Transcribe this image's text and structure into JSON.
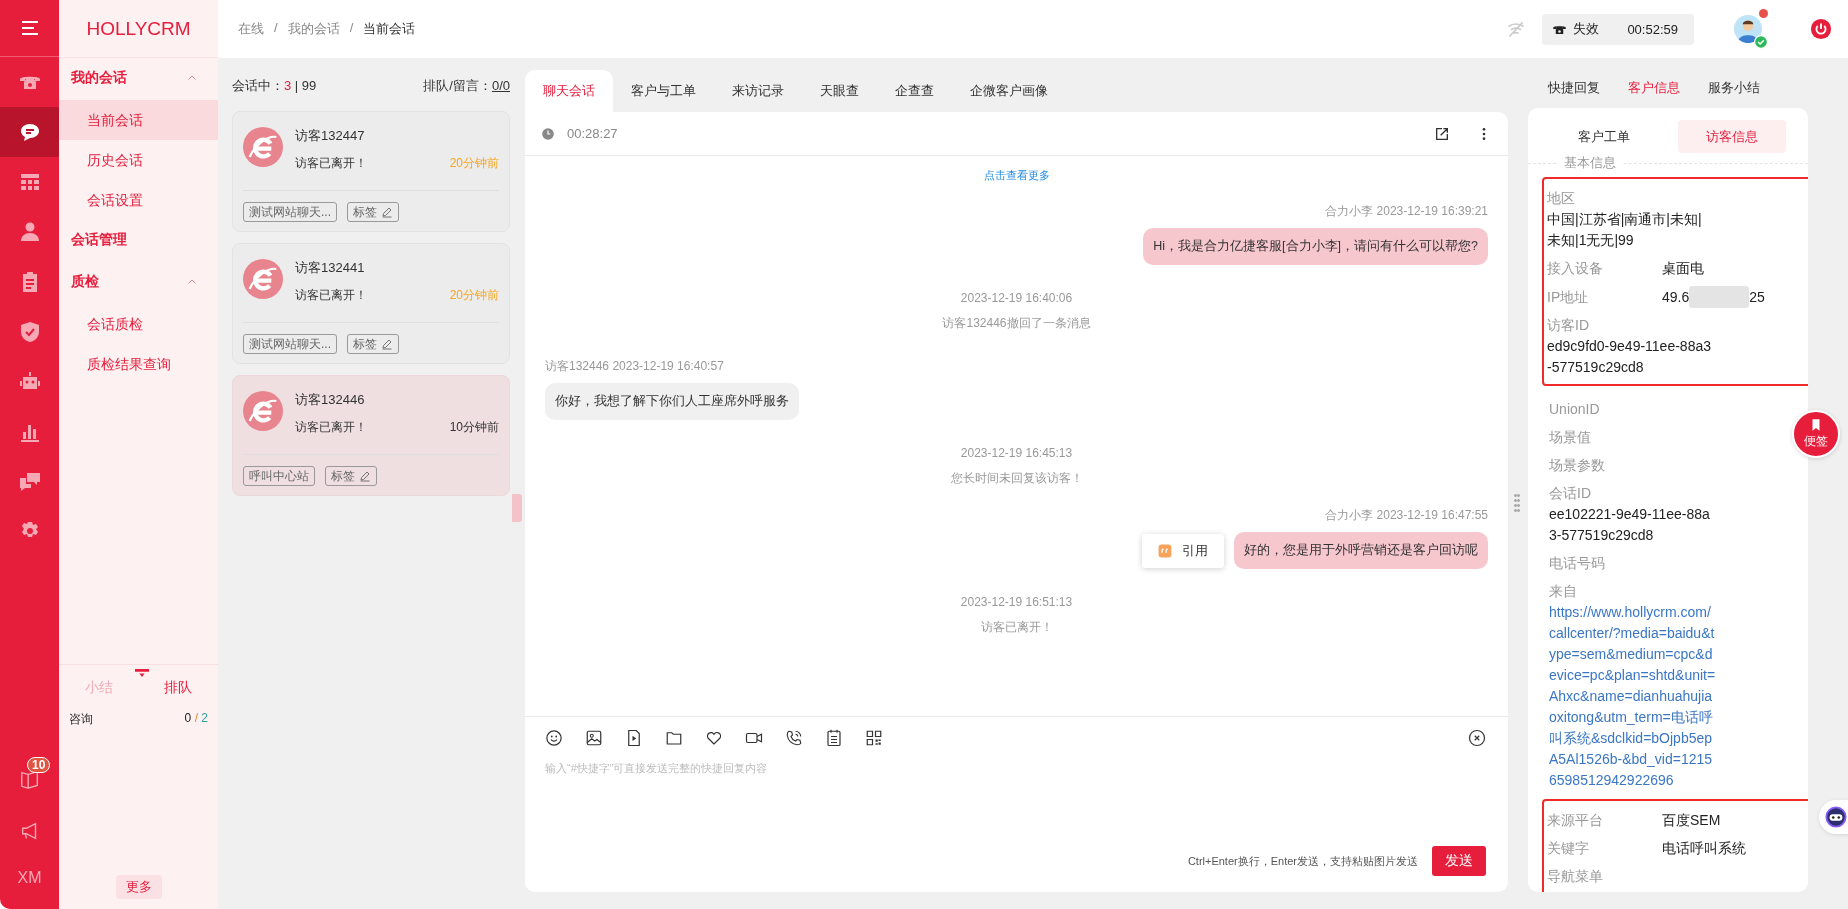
{
  "rail": {
    "items": [
      {
        "selected": false
      },
      {
        "selected": true
      },
      {
        "selected": false
      },
      {
        "selected": false
      },
      {
        "selected": false
      },
      {
        "selected": false
      },
      {
        "selected": false
      },
      {
        "selected": false
      },
      {
        "selected": false
      },
      {
        "selected": false
      }
    ],
    "badge": "10",
    "user": "XM"
  },
  "brand": "HOLLYCRM",
  "menu": {
    "groups": [
      {
        "label": "我的会话",
        "expanded": true,
        "items": [
          {
            "label": "当前会话",
            "selected": true
          },
          {
            "label": "历史会话",
            "selected": false
          },
          {
            "label": "会话设置",
            "selected": false
          }
        ]
      },
      {
        "label": "会话管理"
      },
      {
        "label": "质检",
        "expanded": true,
        "items": [
          {
            "label": "会话质检",
            "selected": false
          },
          {
            "label": "质检结果查询",
            "selected": false
          }
        ]
      }
    ],
    "summary": {
      "tabs": [
        {
          "label": "小结",
          "selected": false
        },
        {
          "label": "排队",
          "selected": true
        }
      ],
      "rows": [
        {
          "label": "咨询",
          "done": "0",
          "separator": "/",
          "total": "2"
        }
      ],
      "more": "更多"
    }
  },
  "topbar": {
    "breadcrumb": [
      "在线",
      "我的会话",
      "当前会话"
    ],
    "separator": "/",
    "status": {
      "label": "失效",
      "timer": "00:52:59"
    }
  },
  "sessions": {
    "label": "会话中：",
    "active": "3",
    "divider": "|",
    "total": "99",
    "queue_label": "排队/留言：",
    "queue": "0/0",
    "cards": [
      {
        "name": "访客132447",
        "status": "访客已离开！",
        "time": "20分钟前",
        "selected": false,
        "source": "测试网站聊天...",
        "tag_button": "标签"
      },
      {
        "name": "访客132441",
        "status": "访客已离开！",
        "time": "20分钟前",
        "selected": false,
        "source": "测试网站聊天...",
        "tag_button": "标签"
      },
      {
        "name": "访客132446",
        "status": "访客已离开！",
        "time": "10分钟前",
        "selected": true,
        "source": "呼叫中心站",
        "tag_button": "标签"
      }
    ]
  },
  "chat": {
    "tabs": [
      {
        "label": "聊天会话",
        "selected": true
      },
      {
        "label": "客户与工单",
        "selected": false
      },
      {
        "label": "来访记录",
        "selected": false
      },
      {
        "label": "天眼查",
        "selected": false
      },
      {
        "label": "企查查",
        "selected": false
      },
      {
        "label": "企微客户画像",
        "selected": false
      }
    ],
    "timer": "00:28:27",
    "load_more": "点击查看更多",
    "messages": [
      {
        "kind": "agent",
        "meta": "合力小李 2023-12-19 16:39:21",
        "text": "Hi，我是合力亿捷客服[合力小李]，请问有什么可以帮您?"
      },
      {
        "kind": "system",
        "time": "2023-12-19 16:40:06",
        "text": "访客132446撤回了一条消息"
      },
      {
        "kind": "visitor",
        "meta": "访客132446 2023-12-19 16:40:57",
        "text": "你好，我想了解下你们人工座席外呼服务"
      },
      {
        "kind": "system",
        "time": "2023-12-19 16:45:13",
        "text": "您长时间未回复该访客！"
      },
      {
        "kind": "agent",
        "meta": "合力小李 2023-12-19 16:47:55",
        "text": "好的，您是用于外呼营销还是客户回访呢",
        "quote": "引用"
      },
      {
        "kind": "system",
        "time": "2023-12-19 16:51:13",
        "text": "访客已离开！"
      }
    ],
    "placeholder": "输入“#快捷字”可直接发送完整的快捷回复内容",
    "hint": "Ctrl+Enter换行，Enter发送，支持粘贴图片发送",
    "send": "发送"
  },
  "right": {
    "tabs": [
      {
        "label": "快捷回复",
        "selected": false
      },
      {
        "label": "客户信息",
        "selected": true
      },
      {
        "label": "服务小结",
        "selected": false
      }
    ],
    "inner_tabs": [
      {
        "label": "客户工单",
        "selected": false
      },
      {
        "label": "访客信息",
        "selected": true
      }
    ],
    "section": "基本信息",
    "groups": [
      {
        "highlighted": true,
        "fields": [
          {
            "kind": "stacked",
            "label": "地区",
            "value": "中国|江苏省|南通市|未知|未知|1无无|99"
          },
          {
            "kind": "inline",
            "label": "接入设备",
            "value": "桌面电"
          },
          {
            "kind": "redacted",
            "label": "IP地址",
            "value": "49.6",
            "value_end": "25"
          },
          {
            "kind": "stacked",
            "label": "访客ID",
            "value": "ed9c9fd0-9e49-11ee-88a3-577519c29cd8"
          }
        ]
      },
      {
        "highlighted": false,
        "fields": [
          {
            "kind": "stacked",
            "label": "UnionID"
          },
          {
            "kind": "stacked",
            "label": "场景值"
          },
          {
            "kind": "stacked",
            "label": "场景参数"
          },
          {
            "kind": "stacked",
            "label": "会话ID",
            "value": "ee102221-9e49-11ee-88a3-577519c29cd8"
          },
          {
            "kind": "stacked",
            "label": "电话号码"
          },
          {
            "kind": "link",
            "label": "来自",
            "value": "https://www.hollycrm.com/callcenter/?media=baidu&type=sem&medium=cpc&device=pc&plan=shtd&unit=Ahxc&name=dianhuahujiaoxitong&utm_term=电话呼叫系统&sdclkid=bOjpb5epA5Al1526b-&bd_vid=12156598512942922696"
          }
        ]
      },
      {
        "highlighted": true,
        "fields": [
          {
            "kind": "inline",
            "label": "来源平台",
            "value": "百度SEM"
          },
          {
            "kind": "inline",
            "label": "关键字",
            "value": "电话呼叫系统"
          },
          {
            "kind": "stacked",
            "label": "导航菜单"
          }
        ]
      }
    ],
    "note_button": "便签"
  }
}
